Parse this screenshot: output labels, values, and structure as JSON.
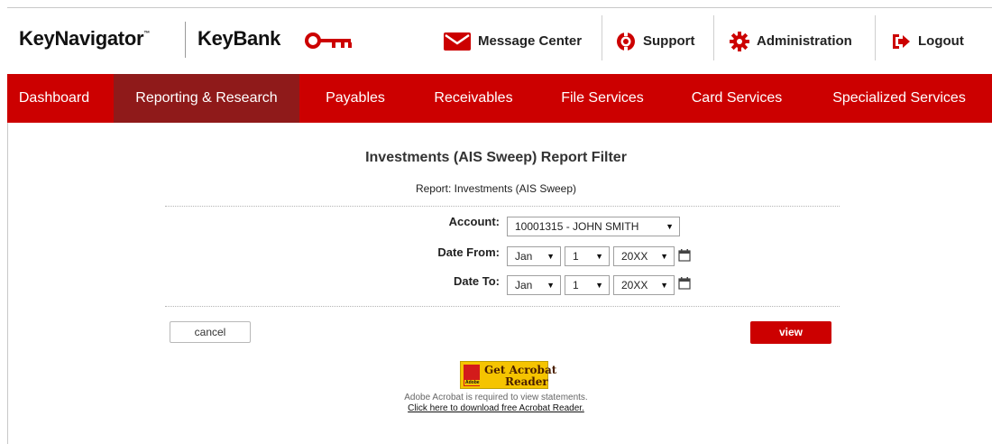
{
  "header": {
    "brand_keynavigator": "KeyNavigator",
    "brand_keynavigator_tm": "™",
    "brand_keybank": "KeyBank",
    "utilities": [
      {
        "label": "Message Center",
        "icon": "envelope-icon"
      },
      {
        "label": "Support",
        "icon": "lifebuoy-icon"
      },
      {
        "label": "Administration",
        "icon": "gear-icon"
      },
      {
        "label": "Logout",
        "icon": "logout-icon"
      }
    ]
  },
  "nav": {
    "items": [
      {
        "label": "Dashboard",
        "active": false
      },
      {
        "label": "Reporting & Research",
        "active": true
      },
      {
        "label": "Payables",
        "active": false
      },
      {
        "label": "Receivables",
        "active": false
      },
      {
        "label": "File Services",
        "active": false
      },
      {
        "label": "Card Services",
        "active": false
      },
      {
        "label": "Specialized Services",
        "active": false
      }
    ]
  },
  "report": {
    "title": "Investments (AIS Sweep) Report Filter",
    "subtitle": "Report: Investments (AIS Sweep)"
  },
  "form": {
    "account_label": "Account:",
    "account_value": "10001315 - JOHN SMITH",
    "date_from_label": "Date From:",
    "date_from": {
      "month": "Jan",
      "day": "1",
      "year": "20XX"
    },
    "date_to_label": "Date To:",
    "date_to": {
      "month": "Jan",
      "day": "1",
      "year": "20XX"
    },
    "cancel_label": "cancel",
    "view_label": "view"
  },
  "acrobat": {
    "badge_line1": "Get Acrobat",
    "badge_line2": "Reader",
    "badge_brand": "Adobe",
    "note": "Adobe Acrobat is required to view statements.",
    "link": "Click here to download free Acrobat Reader."
  },
  "colors": {
    "brand_red": "#cc0000",
    "nav_active": "#8f1a1a",
    "acrobat_yellow": "#f5c400"
  }
}
